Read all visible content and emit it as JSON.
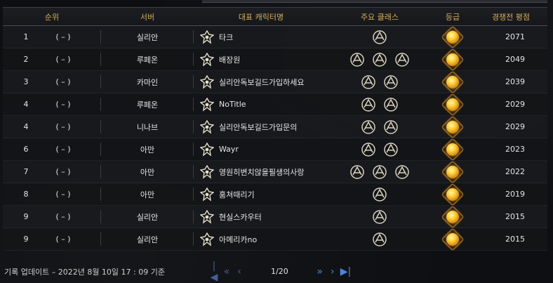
{
  "table": {
    "headers": {
      "rank": "순위",
      "server": "서버",
      "character": "대표 캐릭터명",
      "classes": "주요 클래스",
      "grade": "등급",
      "score": "경쟁전 평점"
    },
    "rows": [
      {
        "rank": "1",
        "change": "( – )",
        "server": "실리안",
        "name": "타크",
        "classes": 1,
        "score": "2071"
      },
      {
        "rank": "2",
        "change": "( – )",
        "server": "루페온",
        "name": "배장원",
        "classes": 3,
        "score": "2049"
      },
      {
        "rank": "3",
        "change": "( – )",
        "server": "카마인",
        "name": "실리안독보길드가입하세요",
        "classes": 2,
        "score": "2039"
      },
      {
        "rank": "4",
        "change": "( – )",
        "server": "루페온",
        "name": "NoTitle",
        "classes": 2,
        "score": "2029"
      },
      {
        "rank": "4",
        "change": "( – )",
        "server": "니나브",
        "name": "실리안독보길드가입문의",
        "classes": 2,
        "score": "2029"
      },
      {
        "rank": "6",
        "change": "( – )",
        "server": "아만",
        "name": "Wayr",
        "classes": 2,
        "score": "2023"
      },
      {
        "rank": "7",
        "change": "( – )",
        "server": "아만",
        "name": "영원히변치않을필생의사랑",
        "classes": 3,
        "score": "2022"
      },
      {
        "rank": "8",
        "change": "( – )",
        "server": "아만",
        "name": "훔쳐때리기",
        "classes": 1,
        "score": "2019"
      },
      {
        "rank": "9",
        "change": "( – )",
        "server": "실리안",
        "name": "현실스카우터",
        "classes": 1,
        "score": "2015"
      },
      {
        "rank": "9",
        "change": "( – )",
        "server": "실리안",
        "name": "아메리카no",
        "classes": 1,
        "score": "2015"
      }
    ]
  },
  "icons": {
    "class_emblem": "class-emblem-icon",
    "grade": "grade-gem-icon",
    "first": "first-page-icon",
    "prev10": "prev-ten-icon",
    "prev": "prev-page-icon",
    "next": "next-page-icon",
    "next10": "next-ten-icon",
    "last": "last-page-icon"
  },
  "colors": {
    "header_text": "#d4ad5c",
    "pager_active": "#4d86e0",
    "pager_inactive": "#3f5f9f"
  },
  "footer": {
    "updated": "기록 업데이트 – 2022년 8월 10일 17 : 09 기준",
    "page": "1/20"
  }
}
